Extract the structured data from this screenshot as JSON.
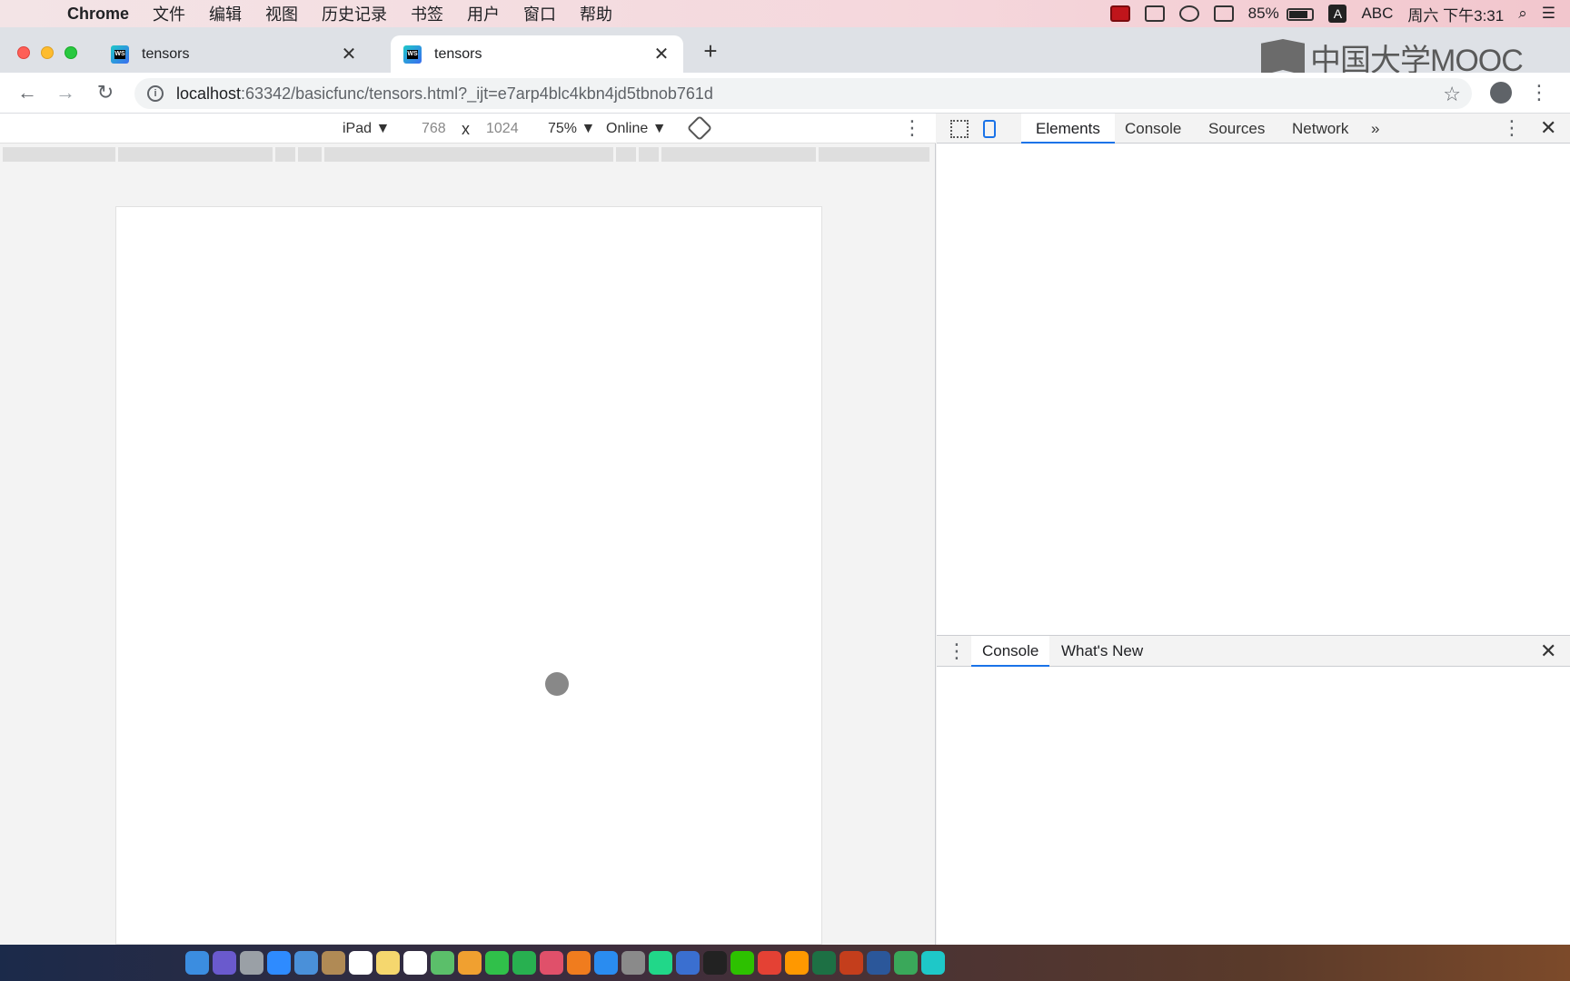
{
  "menubar": {
    "app_name": "Chrome",
    "menus": [
      "文件",
      "编辑",
      "视图",
      "历史记录",
      "书签",
      "用户",
      "窗口",
      "帮助"
    ],
    "battery_percent": "85%",
    "battery_level": 0.85,
    "input_method": "ABC",
    "ime_letter": "A",
    "datetime": "周六 下午3:31"
  },
  "tabs": [
    {
      "title": "tensors",
      "active": false,
      "favicon_text": "WS"
    },
    {
      "title": "tensors",
      "active": true,
      "favicon_text": "WS"
    }
  ],
  "tab_close_glyph": "✕",
  "new_tab_glyph": "+",
  "watermark": {
    "text": "中国大学MOOC"
  },
  "address_bar": {
    "host": "localhost",
    "path": ":63342/basicfunc/tensors.html?_ijt=e7arp4blc4kbn4jd5tbnob761d"
  },
  "device_toolbar": {
    "device": "iPad ▼",
    "width": "768",
    "times": "x",
    "height": "1024",
    "zoom": "75% ▼",
    "network": "Online ▼"
  },
  "devtools": {
    "tabs": [
      "Elements",
      "Console",
      "Sources",
      "Network"
    ],
    "more_tabs": "»",
    "selected_tab": "Elements",
    "drawer_tabs": [
      "Console",
      "What's New"
    ],
    "drawer_selected": "Console"
  },
  "colors": {
    "accent": "#1a73e8",
    "close_red": "#fe5f57",
    "minimize_yellow": "#febc2e",
    "maximize_green": "#28c840"
  },
  "icons": {
    "apple": "apple-icon",
    "back": "back-arrow-icon",
    "forward": "forward-arrow-icon",
    "reload": "reload-icon",
    "info": "info-icon",
    "bookmark": "star-icon",
    "profile": "account-icon",
    "menu": "kebab-menu-icon",
    "rotate": "rotate-icon",
    "inspect": "inspect-element-icon",
    "device": "device-toggle-icon"
  },
  "dock_apps": [
    "Finder",
    "Siri",
    "Launchpad",
    "Safari",
    "Preview",
    "Contacts",
    "Calendar",
    "Notes",
    "Reminders",
    "Maps",
    "Photos",
    "Messages",
    "FaceTime",
    "iTunes",
    "iBooks",
    "App Store",
    "System Preferences",
    "PyCharm",
    "Keynote",
    "Terminal",
    "WeChat",
    "Chrome",
    "Sublime",
    "Excel",
    "PowerPoint",
    "Word",
    "Camtasia",
    "WebStorm"
  ]
}
